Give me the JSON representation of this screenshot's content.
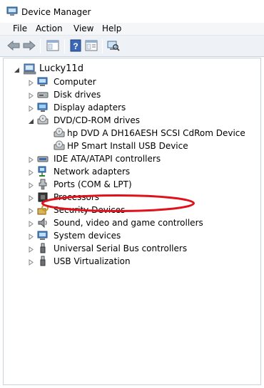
{
  "window": {
    "title": "Device Manager"
  },
  "menu": {
    "file": "File",
    "action": "Action",
    "view": "View",
    "help": "Help"
  },
  "toolbar": {
    "icons": [
      "back-arrow-icon",
      "forward-arrow-icon",
      "show-hide-tree-icon",
      "help-icon",
      "properties-icon",
      "scan-hardware-icon"
    ]
  },
  "tree": {
    "root": "Lucky11d",
    "items": [
      {
        "label": "Computer",
        "icon": "computer-icon"
      },
      {
        "label": "Disk drives",
        "icon": "disk-drive-icon"
      },
      {
        "label": "Display adapters",
        "icon": "display-adapter-icon"
      },
      {
        "label": "DVD/CD-ROM drives",
        "icon": "dvd-drive-icon",
        "children": [
          {
            "label": "hp DVD A  DH16AESH SCSI CdRom Device",
            "icon": "dvd-drive-icon"
          },
          {
            "label": "HP Smart Install USB Device",
            "icon": "dvd-drive-icon",
            "highlighted": true
          }
        ]
      },
      {
        "label": "IDE ATA/ATAPI controllers",
        "icon": "ide-controller-icon"
      },
      {
        "label": "Network adapters",
        "icon": "network-adapter-icon"
      },
      {
        "label": "Ports (COM & LPT)",
        "icon": "port-icon"
      },
      {
        "label": "Processors",
        "icon": "processor-icon"
      },
      {
        "label": "Security Devices",
        "icon": "security-device-icon"
      },
      {
        "label": "Sound, video and game controllers",
        "icon": "sound-icon"
      },
      {
        "label": "System devices",
        "icon": "system-device-icon"
      },
      {
        "label": "Universal Serial Bus controllers",
        "icon": "usb-icon"
      },
      {
        "label": "USB Virtualization",
        "icon": "usb-icon"
      }
    ]
  },
  "colors": {
    "highlight_ring": "#e0111a",
    "toolbar_bg": "#eef2f6",
    "menubar_bg": "#f5f6f7"
  }
}
